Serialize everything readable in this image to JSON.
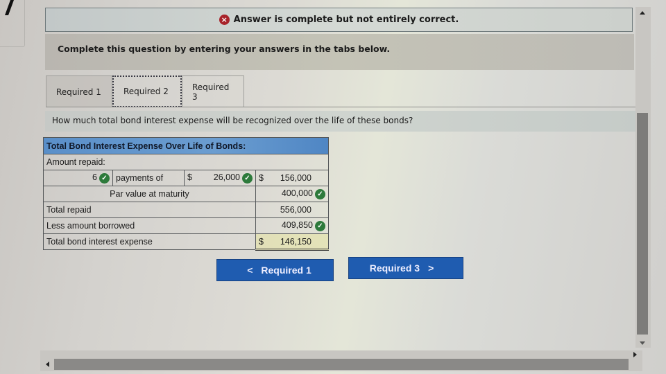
{
  "alert": {
    "icon": "error-x-icon",
    "text": "Answer is complete but not entirely correct."
  },
  "instruction": "Complete this question by entering your answers in the tabs below.",
  "tabs": [
    {
      "label": "Required 1"
    },
    {
      "label": "Required 2",
      "active": true
    },
    {
      "label": "Required 3"
    }
  ],
  "question": "How much total bond interest expense will be recognized over the life of these bonds?",
  "table": {
    "title": "Total Bond Interest Expense Over Life of Bonds:",
    "amount_repaid_label": "Amount repaid:",
    "payments_count": "6",
    "payments_label": "payments of",
    "currency": "$",
    "payment_amount": "26,000",
    "payments_total": "156,000",
    "par_label": "Par value at maturity",
    "par_value": "400,000",
    "total_repaid_label": "Total repaid",
    "total_repaid": "556,000",
    "less_borrowed_label": "Less amount borrowed",
    "less_borrowed": "409,850",
    "interest_label": "Total bond interest expense",
    "interest_value": "146,150",
    "check_glyph": "✓"
  },
  "nav": {
    "prev_label": "Required 1",
    "next_label": "Required 3",
    "prev_glyph": "<",
    "next_glyph": ">"
  },
  "colors": {
    "button_blue": "#1f5cb0",
    "check_green": "#2d7a3b",
    "error_red": "#a8232a",
    "table_header_blue": "#5a8fc9"
  }
}
